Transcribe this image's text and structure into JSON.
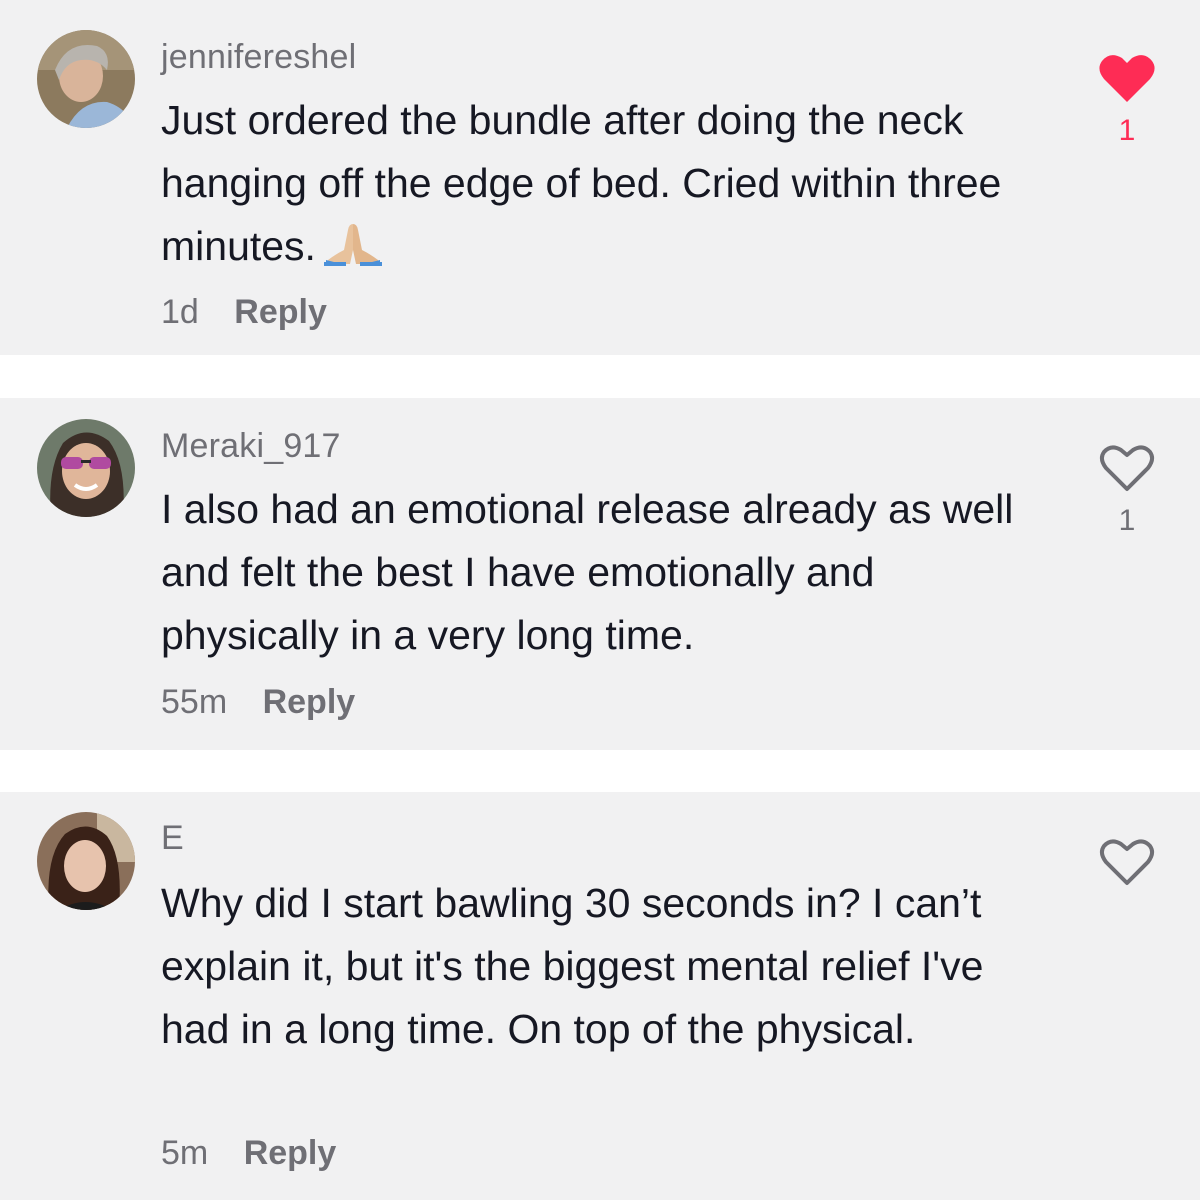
{
  "comments": [
    {
      "username": "jennifereshel",
      "text": "Just ordered the bundle after doing the neck hanging off the edge of bed. Cried within three minutes.",
      "emoji": "folded-hands-icon",
      "time": "1d",
      "reply_label": "Reply",
      "likes": "1",
      "liked": true
    },
    {
      "username": "Meraki_917",
      "text": "I also had an emotional release already as well and felt the best I have emotionally and physically in a very long time.",
      "time": "55m",
      "reply_label": "Reply",
      "likes": "1",
      "liked": false
    },
    {
      "username": "E",
      "text": "Why did I start bawling 30 seconds in? I can’t explain it, but it's the biggest mental relief I've had in a long time. On top of the physical.",
      "time": "5m",
      "reply_label": "Reply",
      "likes": "",
      "liked": false
    }
  ],
  "colors": {
    "card_background": "#f1f1f2",
    "liked_heart": "#fe2c55",
    "muted_text": "#6f6f75",
    "body_text": "#161823"
  }
}
